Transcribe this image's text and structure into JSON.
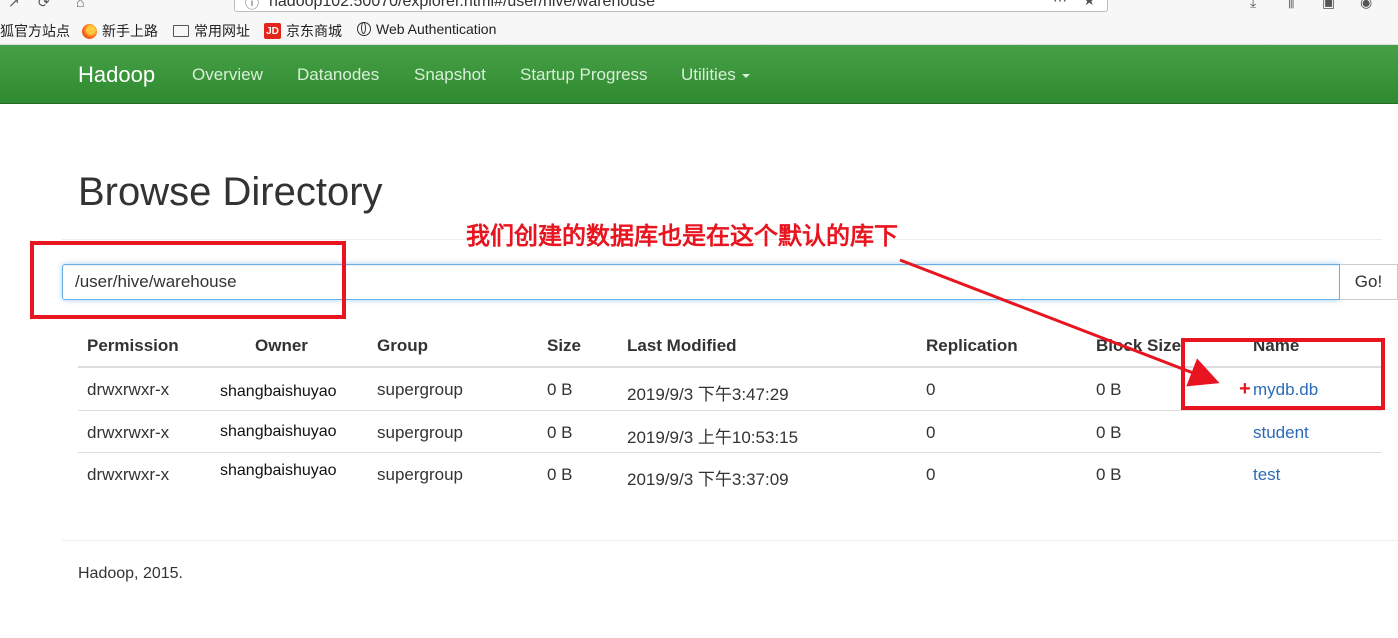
{
  "browser": {
    "url": "hadoop102:50070/explorer.html#/user/hive/warehouse",
    "bookmarks": [
      {
        "label": "狐官方站点",
        "icon": "none"
      },
      {
        "label": "新手上路",
        "icon": "firefox-icon"
      },
      {
        "label": "常用网址",
        "icon": "folder-icon"
      },
      {
        "label": "京东商城",
        "icon": "jd-icon"
      },
      {
        "label": "Web Authentication",
        "icon": "globe-icon"
      }
    ]
  },
  "navbar": {
    "brand": "Hadoop",
    "links": [
      "Overview",
      "Datanodes",
      "Snapshot",
      "Startup Progress",
      "Utilities"
    ]
  },
  "page": {
    "title": "Browse Directory",
    "path_value": "/user/hive/warehouse",
    "go_label": "Go!"
  },
  "annotation": {
    "text": "我们创建的数据库也是在这个默认的库下",
    "color": "#e8141f"
  },
  "table": {
    "headers": [
      "Permission",
      "Owner",
      "Group",
      "Size",
      "Last Modified",
      "Replication",
      "Block Size",
      "Name"
    ],
    "rows": [
      [
        "drwxrwxr-x",
        "shangbaishuyao",
        "supergroup",
        "0 B",
        "2019/9/3 下午3:47:29",
        "0",
        "0 B",
        "mydb.db"
      ],
      [
        "drwxrwxr-x",
        "shangbaishuyao",
        "supergroup",
        "0 B",
        "2019/9/3 上午10:53:15",
        "0",
        "0 B",
        "student"
      ],
      [
        "drwxrwxr-x",
        "shangbaishuyao",
        "supergroup",
        "0 B",
        "2019/9/3 下午3:37:09",
        "0",
        "0 B",
        "test"
      ]
    ]
  },
  "footer": "Hadoop, 2015.",
  "colors": {
    "navbar": "#3a943a",
    "link": "#2a6bb8",
    "annotation": "#e8141f"
  }
}
